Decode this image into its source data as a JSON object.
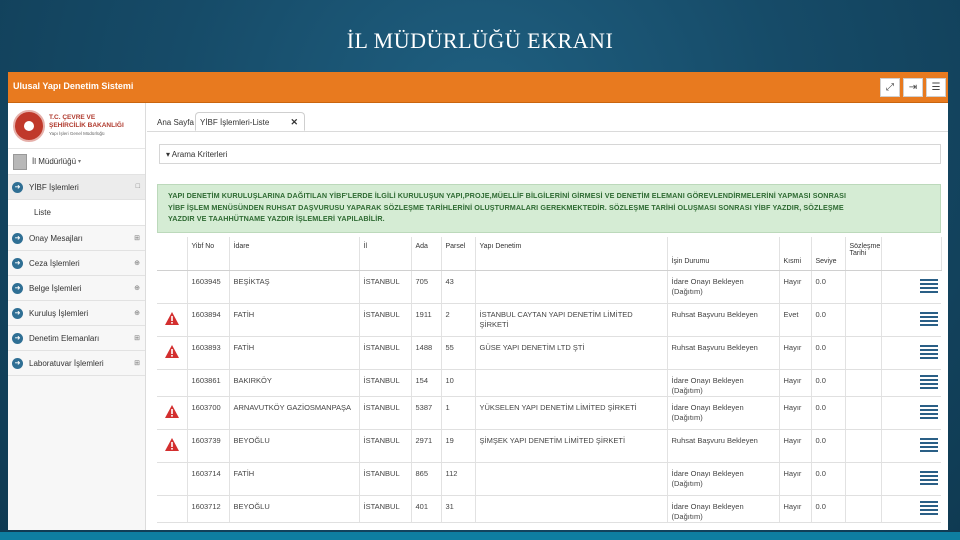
{
  "slide_title": "İL MÜDÜRLÜĞÜ EKRANI",
  "app": {
    "title": "Ulusal Yapı Denetim Sistemi",
    "top_icons": [
      "expand-icon",
      "logout-icon",
      "menu-icon"
    ]
  },
  "logo": {
    "line1": "T.C. ÇEVRE VE",
    "line2": "ŞEHİRCİLİK BAKANLIĞI",
    "line3": "Yapı İşleri Genel Müdürlüğü"
  },
  "user": {
    "label": "İl Müdürlüğü"
  },
  "sidebar": {
    "items": [
      {
        "label": "YİBF İşlemleri",
        "mark": "□"
      },
      {
        "label": "Liste",
        "mark": ""
      },
      {
        "label": "Onay Mesajları",
        "mark": "⊞"
      },
      {
        "label": "Ceza İşlemleri",
        "mark": "⊕"
      },
      {
        "label": "Belge İşlemleri",
        "mark": "⊕"
      },
      {
        "label": "Kuruluş İşlemleri",
        "mark": "⊕"
      },
      {
        "label": "Denetim Elemanları",
        "mark": "⊞"
      },
      {
        "label": "Laboratuvar İşlemleri",
        "mark": "⊞"
      }
    ]
  },
  "tabs": {
    "home": "Ana Sayfa",
    "active": "YİBF İşlemleri-Liste",
    "close": "✕"
  },
  "criteria": {
    "label": "Arama Kriterleri"
  },
  "notice": {
    "line1": "YAPI DENETİM KURULUŞLARINA DAĞITILAN YİBF'LERDE İLGİLİ KURULUŞUN YAPI,PROJE,MÜELLİF BİLGİLERİNİ GİRMESİ VE DENETİM ELEMANI GÖREVLENDİRMELERİNİ YAPMASI SONRASI",
    "line2": "YİBF İŞLEM MENÜSÜNDEN RUHSAT DAŞVURUSU YAPARAK SÖZLEŞME TARİHLERİNİ OLUŞTURMALARI GEREKMEKTEDİR. SÖZLEŞME TARİHİ OLUŞMASI SONRASI YİBF YAZDIR, SÖZLEŞME",
    "line3": "YAZDIR VE TAAHHÜTNAME YAZDIR İŞLEMLERİ YAPILABİLİR."
  },
  "table": {
    "headers": {
      "yibf": "Yibf No",
      "idare": "İdare",
      "il": "İl",
      "ada": "Ada",
      "parsel": "Parsel",
      "denetim": "Yapı Denetim",
      "durum": "İşin Durumu",
      "kismi": "Kısmi",
      "seviye": "Seviye",
      "sozlesme": "Sözleşme Tarihi"
    },
    "rows": [
      {
        "warn": false,
        "yibf": "1603945",
        "idare": "BEŞİKTAŞ",
        "il": "İSTANBUL",
        "ada": "705",
        "parsel": "43",
        "denetim": "",
        "durum": "İdare Onayı Bekleyen (Dağıtım)",
        "kismi": "Hayır",
        "seviye": "0.0",
        "sozlesme": ""
      },
      {
        "warn": true,
        "yibf": "1603894",
        "idare": "FATİH",
        "il": "İSTANBUL",
        "ada": "1911",
        "parsel": "2",
        "denetim": "İSTANBUL CAYTAN YAPI DENETİM LİMİTED ŞİRKETİ",
        "durum": "Ruhsat Başvuru Bekleyen",
        "kismi": "Evet",
        "seviye": "0.0",
        "sozlesme": ""
      },
      {
        "warn": true,
        "yibf": "1603893",
        "idare": "FATİH",
        "il": "İSTANBUL",
        "ada": "1488",
        "parsel": "55",
        "denetim": "GÜSE YAPI DENETİM LTD ŞTİ",
        "durum": "Ruhsat Başvuru Bekleyen",
        "kismi": "Hayır",
        "seviye": "0.0",
        "sozlesme": ""
      },
      {
        "warn": false,
        "yibf": "1603861",
        "idare": "BAKIRKÖY",
        "il": "İSTANBUL",
        "ada": "154",
        "parsel": "10",
        "denetim": "",
        "durum": "İdare Onayı Bekleyen (Dağıtım)",
        "kismi": "Hayır",
        "seviye": "0.0",
        "sozlesme": ""
      },
      {
        "warn": true,
        "yibf": "1603700",
        "idare": "ARNAVUTKÖY GAZİOSMANPAŞA",
        "il": "İSTANBUL",
        "ada": "5387",
        "parsel": "1",
        "denetim": "YÜKSELEN YAPI DENETİM LİMİTED ŞİRKETİ",
        "durum": "İdare Onayı Bekleyen (Dağıtım)",
        "kismi": "Hayır",
        "seviye": "0.0",
        "sozlesme": ""
      },
      {
        "warn": true,
        "yibf": "1603739",
        "idare": "BEYOĞLU",
        "il": "İSTANBUL",
        "ada": "2971",
        "parsel": "19",
        "denetim": "ŞİMŞEK YAPI DENETİM LİMİTED ŞİRKETİ",
        "durum": "Ruhsat Başvuru Bekleyen",
        "kismi": "Hayır",
        "seviye": "0.0",
        "sozlesme": ""
      },
      {
        "warn": false,
        "yibf": "1603714",
        "idare": "FATİH",
        "il": "İSTANBUL",
        "ada": "865",
        "parsel": "112",
        "denetim": "",
        "durum": "İdare Onayı Bekleyen (Dağıtım)",
        "kismi": "Hayır",
        "seviye": "0.0",
        "sozlesme": ""
      },
      {
        "warn": false,
        "yibf": "1603712",
        "idare": "BEYOĞLU",
        "il": "İSTANBUL",
        "ada": "401",
        "parsel": "31",
        "denetim": "",
        "durum": "İdare Onayı Bekleyen (Dağıtım)",
        "kismi": "Hayır",
        "seviye": "0.0",
        "sozlesme": ""
      }
    ]
  },
  "colors": {
    "topbar": "#e87a1f",
    "notice_bg": "#d5ecd4",
    "notice_text": "#2f6b33",
    "warning": "#d32f2f",
    "menu_icon": "#2a5f86",
    "slide_bg": "#164b68"
  }
}
